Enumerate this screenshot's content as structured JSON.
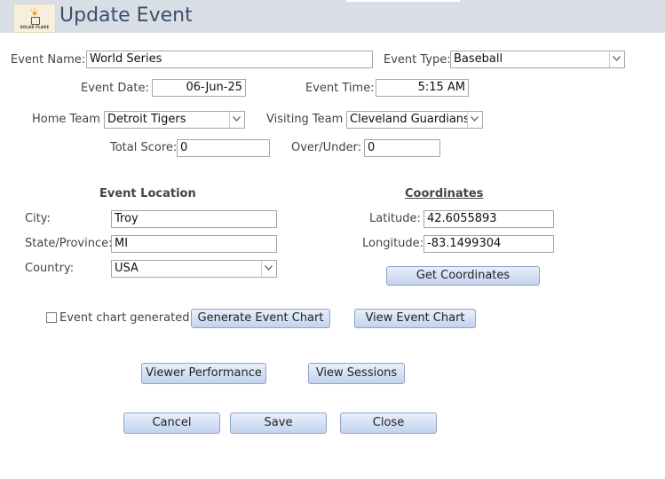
{
  "header": {
    "title": "Update Event",
    "logo_text": "SOLAR FLARE"
  },
  "form": {
    "event_name": {
      "label": "Event Name:",
      "value": "World Series"
    },
    "event_type": {
      "label": "Event Type:",
      "value": "Baseball"
    },
    "event_date": {
      "label": "Event Date:",
      "value": "06-Jun-25"
    },
    "event_time": {
      "label": "Event Time:",
      "value": "5:15 AM"
    },
    "home_team": {
      "label": "Home Team",
      "value": "Detroit Tigers"
    },
    "visiting_team": {
      "label": "Visiting Team",
      "value": "Cleveland Guardians"
    },
    "total_score": {
      "label": "Total Score:",
      "value": "0"
    },
    "over_under": {
      "label": "Over/Under:",
      "value": "0"
    }
  },
  "location": {
    "heading": "Event Location",
    "city": {
      "label": "City:",
      "value": "Troy"
    },
    "state": {
      "label": "State/Province:",
      "value": "MI"
    },
    "country": {
      "label": "Country:",
      "value": "USA"
    }
  },
  "coordinates": {
    "heading": "Coordinates",
    "latitude": {
      "label": "Latitude:",
      "value": "42.6055893"
    },
    "longitude": {
      "label": "Longitude:",
      "value": "-83.1499304"
    },
    "get_button": "Get Coordinates"
  },
  "chart": {
    "checkbox_label": "Event chart generated",
    "checked": false,
    "generate_button": "Generate Event Chart",
    "view_button": "View Event Chart"
  },
  "actions": {
    "viewer_performance": "Viewer Performance",
    "view_sessions": "View Sessions",
    "cancel": "Cancel",
    "save": "Save",
    "close": "Close"
  }
}
